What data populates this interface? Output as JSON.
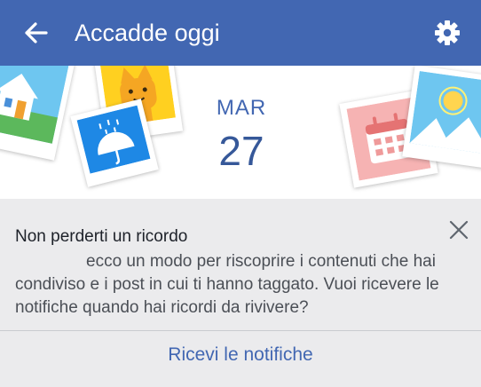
{
  "header": {
    "title": "Accadde oggi",
    "back_icon": "arrow-left-icon",
    "settings_icon": "gear-icon",
    "color": "#4267b2"
  },
  "hero": {
    "month": "MAR",
    "day": "27",
    "decorative_icons": [
      "house-photo-icon",
      "cat-photo-icon",
      "rain-umbrella-photo-icon",
      "calendar-photo-icon",
      "sun-landscape-photo-icon"
    ]
  },
  "notice": {
    "title": "Non perderti un ricordo",
    "body": "ecco un modo per riscoprire i contenuti che hai condiviso e i post in cui ti hanno taggato. Vuoi ricevere le notifiche quando hai ricordi da rivivere?",
    "close_icon": "close-icon",
    "cta_label": "Ricevi le notifiche",
    "accent_color": "#4267b2"
  }
}
